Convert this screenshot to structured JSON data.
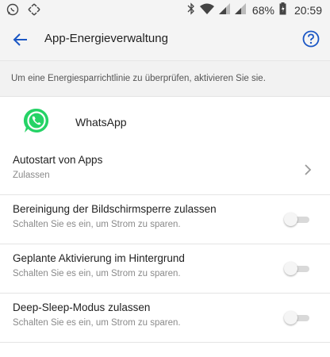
{
  "status_bar": {
    "left_icons": [
      "whatsapp-icon",
      "move-icon"
    ],
    "right_icons": [
      "bluetooth-icon",
      "wifi-icon",
      "signal-icon",
      "signal-icon",
      "battery-icon"
    ],
    "battery_percent": "68%",
    "time": "20:59"
  },
  "toolbar": {
    "title": "App-Energieverwaltung",
    "back_icon": "arrow-left-icon",
    "help_icon": "help-circle-icon",
    "accent_color": "#1a56c4"
  },
  "info": {
    "text": "Um eine Energiesparrichtlinie zu überprüfen, aktivieren Sie sie."
  },
  "app": {
    "name": "WhatsApp",
    "icon": "whatsapp-icon",
    "brand_color": "#25d366"
  },
  "settings": [
    {
      "title": "Autostart von Apps",
      "subtitle": "Zulassen",
      "control": "chevron"
    },
    {
      "title": "Bereinigung der Bildschirmsperre zulassen",
      "subtitle": "Schalten Sie es ein, um Strom zu sparen.",
      "control": "toggle",
      "enabled": false
    },
    {
      "title": "Geplante Aktivierung im Hintergrund",
      "subtitle": "Schalten Sie es ein, um Strom zu sparen.",
      "control": "toggle",
      "enabled": false
    },
    {
      "title": "Deep-Sleep-Modus zulassen",
      "subtitle": "Schalten Sie es ein, um Strom zu sparen.",
      "control": "toggle",
      "enabled": false
    }
  ]
}
